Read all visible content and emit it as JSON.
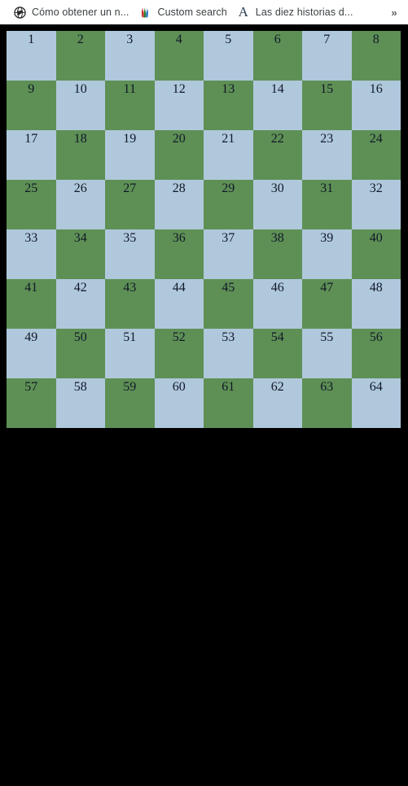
{
  "bookmarks_bar": {
    "items": [
      {
        "icon": "globe-icon",
        "label": "Cómo obtener un n..."
      },
      {
        "icon": "flame-multicolor-icon",
        "label": "Custom search"
      },
      {
        "icon": "letter-a-icon",
        "label": "Las diez historias d..."
      }
    ],
    "overflow_label": "»"
  },
  "colors": {
    "page_background": "#000000",
    "bar_background": "#ffffff",
    "bookmark_text": "#3c4043",
    "cell_light": "#b0c8dc",
    "cell_dark": "#5e9055",
    "cell_number_text": "#101828"
  },
  "checkerboard": {
    "rows": 8,
    "columns": 8,
    "cells": [
      [
        {
          "n": "1",
          "shade": "light"
        },
        {
          "n": "2",
          "shade": "dark"
        },
        {
          "n": "3",
          "shade": "light"
        },
        {
          "n": "4",
          "shade": "dark"
        },
        {
          "n": "5",
          "shade": "light"
        },
        {
          "n": "6",
          "shade": "dark"
        },
        {
          "n": "7",
          "shade": "light"
        },
        {
          "n": "8",
          "shade": "dark"
        }
      ],
      [
        {
          "n": "9",
          "shade": "dark"
        },
        {
          "n": "10",
          "shade": "light"
        },
        {
          "n": "11",
          "shade": "dark"
        },
        {
          "n": "12",
          "shade": "light"
        },
        {
          "n": "13",
          "shade": "dark"
        },
        {
          "n": "14",
          "shade": "light"
        },
        {
          "n": "15",
          "shade": "dark"
        },
        {
          "n": "16",
          "shade": "light"
        }
      ],
      [
        {
          "n": "17",
          "shade": "light"
        },
        {
          "n": "18",
          "shade": "dark"
        },
        {
          "n": "19",
          "shade": "light"
        },
        {
          "n": "20",
          "shade": "dark"
        },
        {
          "n": "21",
          "shade": "light"
        },
        {
          "n": "22",
          "shade": "dark"
        },
        {
          "n": "23",
          "shade": "light"
        },
        {
          "n": "24",
          "shade": "dark"
        }
      ],
      [
        {
          "n": "25",
          "shade": "dark"
        },
        {
          "n": "26",
          "shade": "light"
        },
        {
          "n": "27",
          "shade": "dark"
        },
        {
          "n": "28",
          "shade": "light"
        },
        {
          "n": "29",
          "shade": "dark"
        },
        {
          "n": "30",
          "shade": "light"
        },
        {
          "n": "31",
          "shade": "dark"
        },
        {
          "n": "32",
          "shade": "light"
        }
      ],
      [
        {
          "n": "33",
          "shade": "light"
        },
        {
          "n": "34",
          "shade": "dark"
        },
        {
          "n": "35",
          "shade": "light"
        },
        {
          "n": "36",
          "shade": "dark"
        },
        {
          "n": "37",
          "shade": "light"
        },
        {
          "n": "38",
          "shade": "dark"
        },
        {
          "n": "39",
          "shade": "light"
        },
        {
          "n": "40",
          "shade": "dark"
        }
      ],
      [
        {
          "n": "41",
          "shade": "dark"
        },
        {
          "n": "42",
          "shade": "light"
        },
        {
          "n": "43",
          "shade": "dark"
        },
        {
          "n": "44",
          "shade": "light"
        },
        {
          "n": "45",
          "shade": "dark"
        },
        {
          "n": "46",
          "shade": "light"
        },
        {
          "n": "47",
          "shade": "dark"
        },
        {
          "n": "48",
          "shade": "light"
        }
      ],
      [
        {
          "n": "49",
          "shade": "light"
        },
        {
          "n": "50",
          "shade": "dark"
        },
        {
          "n": "51",
          "shade": "light"
        },
        {
          "n": "52",
          "shade": "dark"
        },
        {
          "n": "53",
          "shade": "light"
        },
        {
          "n": "54",
          "shade": "dark"
        },
        {
          "n": "55",
          "shade": "light"
        },
        {
          "n": "56",
          "shade": "dark"
        }
      ],
      [
        {
          "n": "57",
          "shade": "dark"
        },
        {
          "n": "58",
          "shade": "light"
        },
        {
          "n": "59",
          "shade": "dark"
        },
        {
          "n": "60",
          "shade": "light"
        },
        {
          "n": "61",
          "shade": "dark"
        },
        {
          "n": "62",
          "shade": "light"
        },
        {
          "n": "63",
          "shade": "dark"
        },
        {
          "n": "64",
          "shade": "light"
        }
      ]
    ]
  }
}
